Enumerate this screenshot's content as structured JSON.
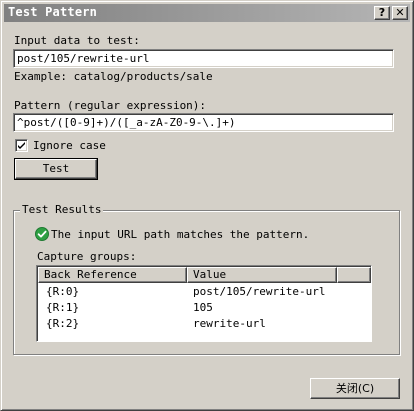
{
  "window": {
    "title": "Test Pattern",
    "help_glyph": "?",
    "close_glyph": "✕"
  },
  "input": {
    "label": "Input data to test:",
    "value": "post/105/rewrite-url",
    "example": "Example: catalog/products/sale"
  },
  "pattern": {
    "label": "Pattern (regular expression):",
    "value": "^post/([0-9]+)/([_a-zA-Z0-9-\\.]+)"
  },
  "ignore_case": {
    "label": "Ignore case",
    "checked": true
  },
  "test_button": {
    "label": "Test"
  },
  "results": {
    "title": "Test Results",
    "status_icon": "check-circle-icon",
    "status_color": "#2ea043",
    "message": "The input URL path matches the pattern.",
    "capture_label": "Capture groups:",
    "columns": [
      "Back Reference",
      "Value"
    ],
    "rows": [
      [
        "{R:0}",
        "post/105/rewrite-url"
      ],
      [
        "{R:1}",
        "105"
      ],
      [
        "{R:2}",
        "rewrite-url"
      ]
    ]
  },
  "close_button": {
    "label": "关闭(C)"
  }
}
